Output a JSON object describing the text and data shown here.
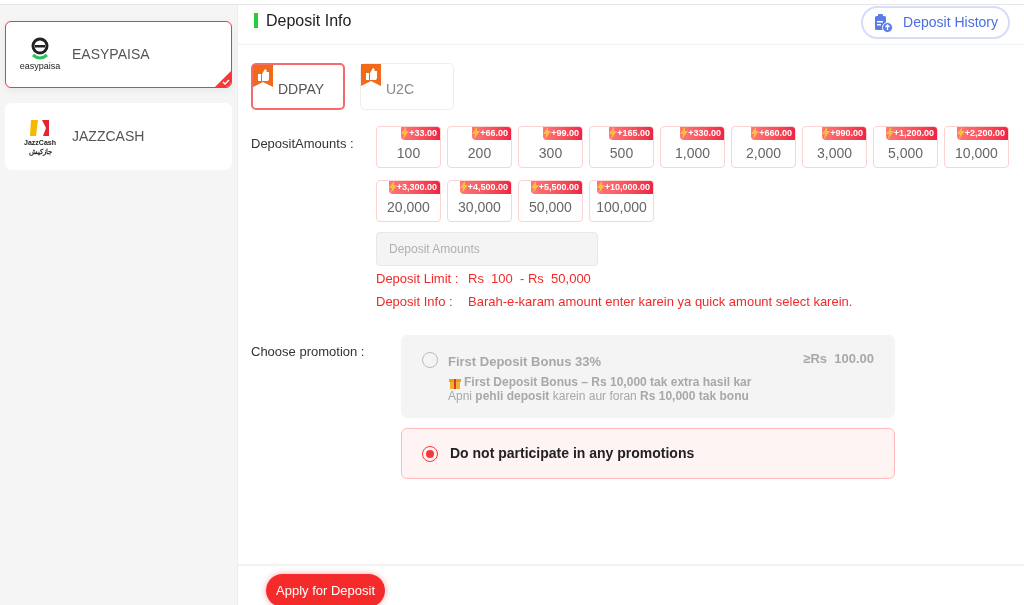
{
  "methods": [
    {
      "name": "EASYPAISA",
      "kind": "easypaisa",
      "logo_text": [
        "easypaisa"
      ],
      "selected": true
    },
    {
      "name": "JAZZCASH",
      "kind": "jazzcash",
      "logo_text": [
        "JazzCash",
        "جازکیش"
      ],
      "selected": false
    }
  ],
  "header": {
    "title": "Deposit Info",
    "history_button": "Deposit History"
  },
  "channels": [
    {
      "name": "DDPAY",
      "selected": true
    },
    {
      "name": "U2C",
      "selected": false
    }
  ],
  "amounts_label": "DepositAmounts :",
  "amounts": [
    {
      "value": "100",
      "bonus": "+33.00"
    },
    {
      "value": "200",
      "bonus": "+66.00"
    },
    {
      "value": "300",
      "bonus": "+99.00"
    },
    {
      "value": "500",
      "bonus": "+165.00"
    },
    {
      "value": "1,000",
      "bonus": "+330.00"
    },
    {
      "value": "2,000",
      "bonus": "+660.00"
    },
    {
      "value": "3,000",
      "bonus": "+990.00"
    },
    {
      "value": "5,000",
      "bonus": "+1,200.00"
    },
    {
      "value": "10,000",
      "bonus": "+2,200.00"
    },
    {
      "value": "20,000",
      "bonus": "+3,300.00"
    },
    {
      "value": "30,000",
      "bonus": "+4,500.00"
    },
    {
      "value": "50,000",
      "bonus": "+5,500.00"
    },
    {
      "value": "100,000",
      "bonus": "+10,000.00"
    }
  ],
  "amount_field": {
    "placeholder": "Deposit Amounts"
  },
  "notes": [
    {
      "label": "Deposit Limit :",
      "text": "Rs  100  - Rs  50,000"
    },
    {
      "label": "Deposit Info :",
      "text": "Barah-e-karam amount enter karein ya quick amount select karein."
    }
  ],
  "promotion_label": "Choose promotion :",
  "promotions": [
    {
      "kind": "bonus",
      "title": "First Deposit Bonus 33%",
      "min": "≥Rs  100.00",
      "lines": [
        "First Deposit Bonus – Rs 10,000 tak extra hasil kar",
        "Apni **pehli deposit** karein aur foran **Rs 10,000 tak bonu**"
      ],
      "selected": false,
      "disabled": true
    },
    {
      "kind": "none",
      "title": "Do not participate in any promotions",
      "selected": true,
      "disabled": false
    }
  ],
  "submit_button": "Apply for Deposit"
}
